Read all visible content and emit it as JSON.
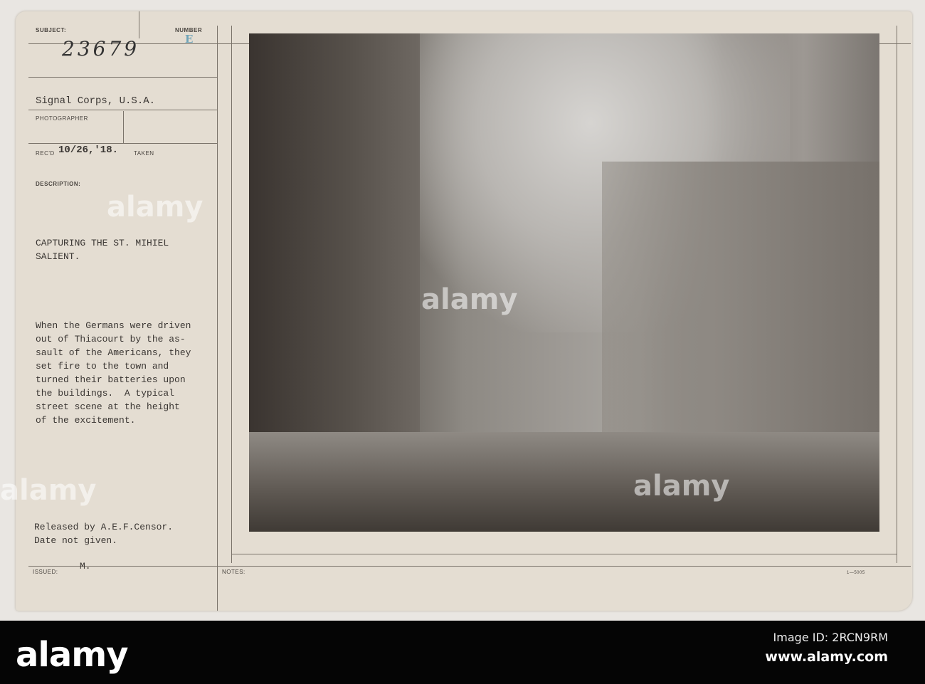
{
  "card": {
    "subject_label": "SUBJECT:",
    "subject_number": "23679",
    "number_label": "NUMBER",
    "number_stamp": "E",
    "photographer_value": "Signal Corps, U.S.A.",
    "photographer_label": "PHOTOGRAPHER",
    "recd_label": "REC'D",
    "recd_value": "10/26,'18.",
    "taken_label": "TAKEN",
    "description_label": "DESCRIPTION:",
    "title": "CAPTURING THE ST. MIHIEL\nSALIENT.",
    "description": "When the Germans were driven\nout of Thiacourt by the as-\nsault of the Americans, they\nset fire to the town and\nturned their batteries upon\nthe buildings.  A typical\nstreet scene at the height\nof the excitement.",
    "release": "Released by A.E.F.Censor.\nDate not given.",
    "issued_label": "ISSUED:",
    "issued_value": "M.",
    "notes_label": "NOTES:",
    "form_number": "1—5005"
  },
  "watermark": "alamy",
  "footer": {
    "logo": "alamy",
    "image_id": "Image ID: 2RCN9RM",
    "url": "www.alamy.com"
  }
}
